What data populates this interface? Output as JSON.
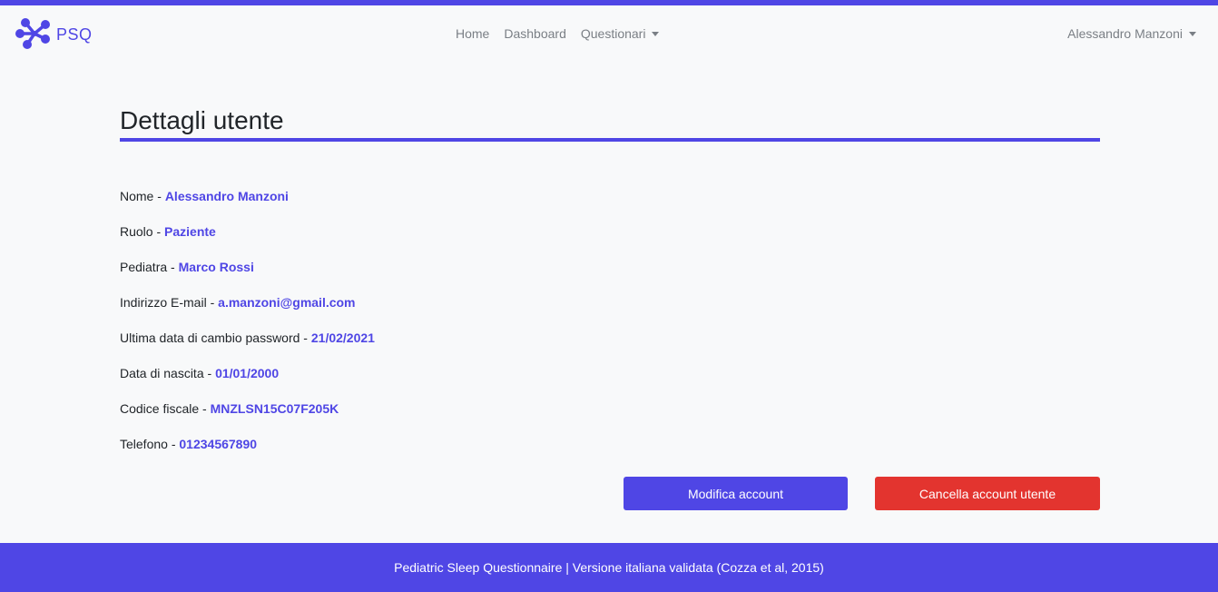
{
  "brand": {
    "name": "PSQ",
    "icon": "molecule-logo-icon",
    "color": "#4f46e5"
  },
  "nav": {
    "items": [
      {
        "label": "Home"
      },
      {
        "label": "Dashboard"
      },
      {
        "label": "Questionari"
      }
    ],
    "user": "Alessandro Manzoni"
  },
  "page": {
    "title": "Dettagli utente"
  },
  "details": [
    {
      "label": "Nome",
      "value": "Alessandro Manzoni"
    },
    {
      "label": "Ruolo",
      "value": "Paziente"
    },
    {
      "label": "Pediatra",
      "value": "Marco Rossi"
    },
    {
      "label": "Indirizzo E-mail",
      "value": "a.manzoni@gmail.com"
    },
    {
      "label": "Ultima data di cambio password",
      "value": "21/02/2021"
    },
    {
      "label": "Data di nascita",
      "value": "01/01/2000"
    },
    {
      "label": "Codice fiscale",
      "value": "MNZLSN15C07F205K"
    },
    {
      "label": "Telefono",
      "value": "01234567890"
    }
  ],
  "separator": " - ",
  "actions": {
    "edit_label": "Modifica account",
    "delete_label": "Cancella account utente"
  },
  "footer": {
    "text": "Pediatric Sleep Questionnaire | Versione italiana validata (Cozza et al, 2015)"
  },
  "colors": {
    "accent": "#4f46e5",
    "danger": "#e3342f"
  }
}
